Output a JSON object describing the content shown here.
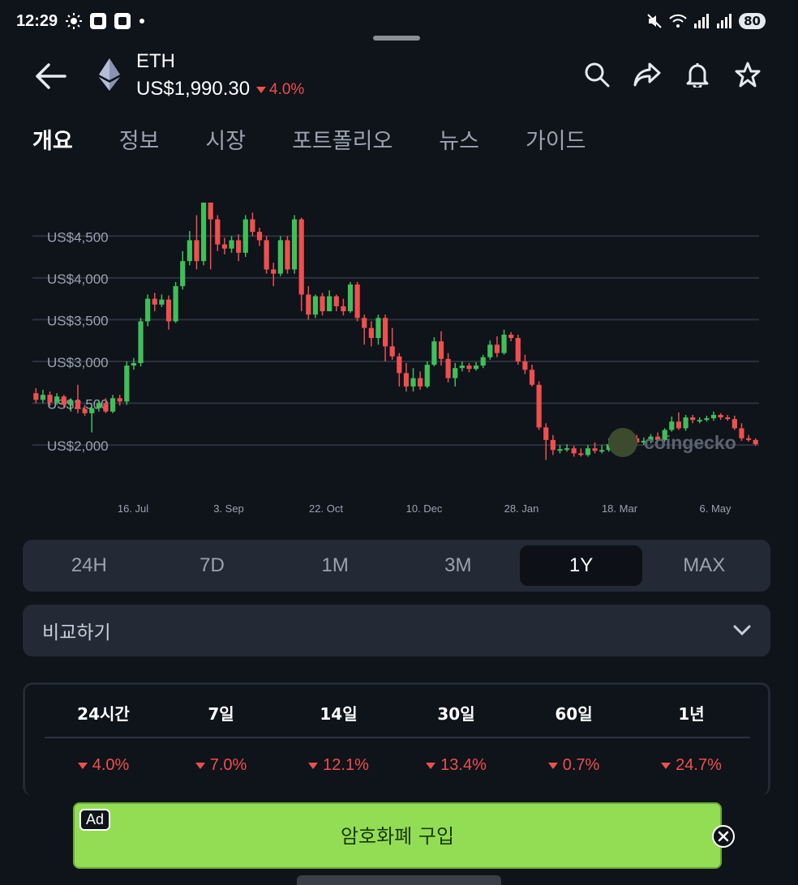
{
  "status_bar": {
    "time": "12:29",
    "battery": "80"
  },
  "coin": {
    "symbol": "ETH",
    "price": "US$1,990.30",
    "change": "4.0%"
  },
  "tabs": [
    {
      "label": "개요",
      "active": true
    },
    {
      "label": "정보",
      "active": false
    },
    {
      "label": "시장",
      "active": false
    },
    {
      "label": "포트폴리오",
      "active": false
    },
    {
      "label": "뉴스",
      "active": false
    },
    {
      "label": "가이드",
      "active": false
    }
  ],
  "chart_data": {
    "type": "candlestick",
    "y_ticks": [
      "US$4,500",
      "US$4,000",
      "US$3,500",
      "US$3,000",
      "US$2,500",
      "US$2,000"
    ],
    "y_tick_values": [
      4500,
      4000,
      3500,
      3000,
      2500,
      2000
    ],
    "x_ticks": [
      "16. Jul",
      "3. Sep",
      "22. Oct",
      "10. Dec",
      "28. Jan",
      "18. Mar",
      "6. May"
    ],
    "ylim": [
      1700,
      4900
    ],
    "grid": true,
    "series": [
      [
        2620,
        2540,
        2680,
        2500
      ],
      [
        2540,
        2600,
        2660,
        2500
      ],
      [
        2600,
        2510,
        2640,
        2470
      ],
      [
        2510,
        2580,
        2620,
        2480
      ],
      [
        2580,
        2480,
        2600,
        2440
      ],
      [
        2480,
        2530,
        2560,
        2400
      ],
      [
        2530,
        2430,
        2720,
        2380
      ],
      [
        2430,
        2380,
        2480,
        2350
      ],
      [
        2380,
        2440,
        2470,
        2150
      ],
      [
        2440,
        2500,
        2540,
        2400
      ],
      [
        2500,
        2400,
        2560,
        2380
      ],
      [
        2400,
        2560,
        2600,
        2380
      ],
      [
        2560,
        2520,
        2600,
        2470
      ],
      [
        2520,
        2950,
        3000,
        2480
      ],
      [
        2950,
        2980,
        3040,
        2900
      ],
      [
        2980,
        3480,
        3520,
        2940
      ],
      [
        3480,
        3750,
        3800,
        3420
      ],
      [
        3750,
        3680,
        3820,
        3600
      ],
      [
        3680,
        3740,
        3800,
        3650
      ],
      [
        3740,
        3480,
        3790,
        3380
      ],
      [
        3480,
        3900,
        3950,
        3460
      ],
      [
        3900,
        4200,
        4320,
        3860
      ],
      [
        4200,
        4450,
        4560,
        4150
      ],
      [
        4450,
        4200,
        4750,
        4100
      ],
      [
        4200,
        4920,
        4980,
        4150
      ],
      [
        4920,
        4700,
        5000,
        4100
      ],
      [
        4700,
        4400,
        4750,
        4320
      ],
      [
        4400,
        4350,
        4480,
        4280
      ],
      [
        4350,
        4450,
        4500,
        4300
      ],
      [
        4450,
        4300,
        4520,
        4200
      ],
      [
        4300,
        4700,
        4750,
        4250
      ],
      [
        4700,
        4550,
        4780,
        4500
      ],
      [
        4550,
        4450,
        4600,
        4380
      ],
      [
        4450,
        4100,
        4500,
        4050
      ],
      [
        4100,
        4050,
        4180,
        3900
      ],
      [
        4050,
        4450,
        4500,
        4020
      ],
      [
        4450,
        4100,
        4500,
        4050
      ],
      [
        4100,
        4700,
        4750,
        4050
      ],
      [
        4700,
        3800,
        4720,
        3600
      ],
      [
        3800,
        3560,
        3900,
        3500
      ],
      [
        3560,
        3780,
        3800,
        3520
      ],
      [
        3780,
        3600,
        3820,
        3550
      ],
      [
        3600,
        3780,
        3850,
        3600
      ],
      [
        3780,
        3660,
        3800,
        3600
      ],
      [
        3660,
        3600,
        3750,
        3550
      ],
      [
        3600,
        3920,
        3950,
        3580
      ],
      [
        3920,
        3520,
        3950,
        3480
      ],
      [
        3520,
        3400,
        3560,
        3200
      ],
      [
        3400,
        3280,
        3480,
        3180
      ],
      [
        3280,
        3520,
        3560,
        3200
      ],
      [
        3520,
        3180,
        3560,
        3000
      ],
      [
        3180,
        3060,
        3400,
        3020
      ],
      [
        3060,
        2860,
        3100,
        2700
      ],
      [
        2860,
        2700,
        2980,
        2640
      ],
      [
        2700,
        2800,
        2920,
        2640
      ],
      [
        2800,
        2700,
        2880,
        2660
      ],
      [
        2700,
        2960,
        3000,
        2680
      ],
      [
        2960,
        3240,
        3290,
        2940
      ],
      [
        3240,
        3030,
        3360,
        2950
      ],
      [
        3030,
        2800,
        3100,
        2750
      ],
      [
        2800,
        2920,
        2980,
        2700
      ],
      [
        2920,
        2950,
        3000,
        2880
      ],
      [
        2950,
        2910,
        2980,
        2870
      ],
      [
        2910,
        2950,
        2990,
        2890
      ],
      [
        2950,
        3050,
        3080,
        2920
      ],
      [
        3050,
        3200,
        3250,
        3020
      ],
      [
        3200,
        3100,
        3300,
        3050
      ],
      [
        3100,
        3320,
        3380,
        3080
      ],
      [
        3320,
        3280,
        3350,
        3240
      ],
      [
        3280,
        3000,
        3320,
        2960
      ],
      [
        3000,
        2900,
        3080,
        2850
      ],
      [
        2900,
        2720,
        2960,
        2700
      ],
      [
        2720,
        2210,
        2760,
        2180
      ],
      [
        2210,
        2060,
        2260,
        1820
      ],
      [
        2060,
        1940,
        2120,
        1880
      ],
      [
        1940,
        1950,
        2000,
        1900
      ],
      [
        1950,
        1960,
        2010,
        1920
      ],
      [
        1960,
        1900,
        1990,
        1860
      ],
      [
        1900,
        1880,
        1960,
        1860
      ],
      [
        1880,
        1960,
        2000,
        1860
      ],
      [
        1960,
        1930,
        2030,
        1900
      ],
      [
        1930,
        1940,
        2000,
        1900
      ],
      [
        1940,
        2010,
        2080,
        1920
      ],
      [
        2010,
        2060,
        2140,
        1980
      ],
      [
        2060,
        2020,
        2200,
        1980
      ],
      [
        2020,
        2080,
        2120,
        2000
      ],
      [
        2080,
        2030,
        2120,
        2000
      ],
      [
        2030,
        2050,
        2090,
        2000
      ],
      [
        2050,
        2100,
        2130,
        2020
      ],
      [
        2100,
        2060,
        2150,
        2040
      ],
      [
        2060,
        2180,
        2200,
        2040
      ],
      [
        2180,
        2280,
        2340,
        2160
      ],
      [
        2280,
        2200,
        2390,
        2180
      ],
      [
        2200,
        2330,
        2360,
        2170
      ],
      [
        2330,
        2300,
        2360,
        2260
      ],
      [
        2300,
        2300,
        2330,
        2260
      ],
      [
        2300,
        2320,
        2350,
        2280
      ],
      [
        2320,
        2360,
        2400,
        2290
      ],
      [
        2360,
        2330,
        2380,
        2300
      ],
      [
        2330,
        2310,
        2360,
        2290
      ],
      [
        2310,
        2200,
        2350,
        2180
      ],
      [
        2200,
        2080,
        2260,
        2050
      ],
      [
        2080,
        2060,
        2120,
        2040
      ],
      [
        2060,
        2010,
        2080,
        1990
      ]
    ]
  },
  "watermark": "coingecko",
  "ranges": [
    {
      "label": "24H",
      "active": false
    },
    {
      "label": "7D",
      "active": false
    },
    {
      "label": "1M",
      "active": false
    },
    {
      "label": "3M",
      "active": false
    },
    {
      "label": "1Y",
      "active": true
    },
    {
      "label": "MAX",
      "active": false
    }
  ],
  "compare": {
    "label": "비교하기"
  },
  "performance": {
    "headers": [
      "24시간",
      "7일",
      "14일",
      "30일",
      "60일",
      "1년"
    ],
    "values": [
      "4.0%",
      "7.0%",
      "12.1%",
      "13.4%",
      "0.7%",
      "24.7%"
    ],
    "down_color": "#ef4f4f"
  },
  "ad": {
    "badge": "Ad",
    "label": "암호화폐 구입"
  },
  "colors": {
    "up": "#3fbf5a",
    "down": "#ef4f4f",
    "bg": "#0f131a",
    "card": "#232a35"
  }
}
